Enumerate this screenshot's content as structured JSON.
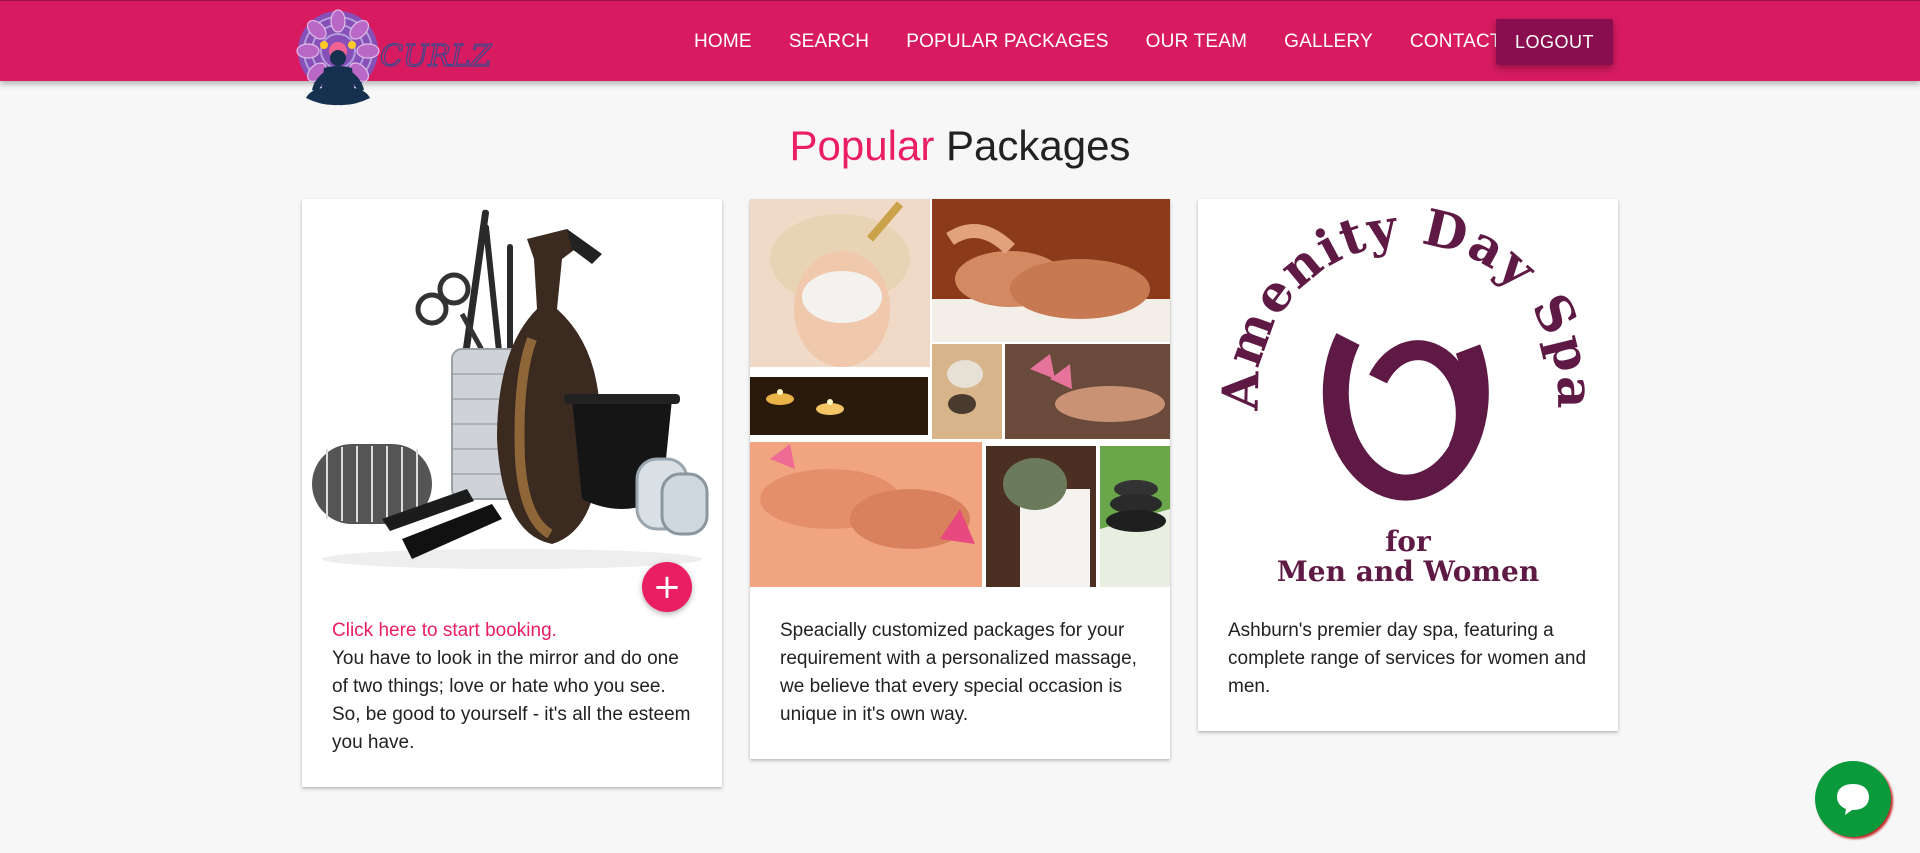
{
  "brand": {
    "logo_text": "CURLZ"
  },
  "nav": {
    "items": [
      {
        "label": "HOME"
      },
      {
        "label": "SEARCH"
      },
      {
        "label": "POPULAR PACKAGES"
      },
      {
        "label": "OUR TEAM"
      },
      {
        "label": "GALLERY"
      },
      {
        "label": "CONTACT"
      }
    ],
    "logout_label": "LOGOUT"
  },
  "section": {
    "title_accent": "Popular",
    "title_rest": " Packages"
  },
  "cards": [
    {
      "image": "hair-tools-image",
      "link_text": "Click here to start booking.",
      "add_icon": "+",
      "text": "You have to look in the mirror and do one of two things; love or hate who you see. So, be good to yourself - it's all the esteem you have."
    },
    {
      "image": "spa-collage-image",
      "text": "Speacially customized packages for your requirement with a personalized massage, we believe that every special occasion is unique in it's own way."
    },
    {
      "image": "amenity-day-spa-logo",
      "logo_arc": "Amenity Day Spa",
      "logo_for": "for",
      "logo_sub": "Men and Women",
      "text": "Ashburn's premier day spa, featuring a complete range of services for women and men."
    }
  ],
  "colors": {
    "primary": "#d81b60",
    "accent": "#e91e63",
    "logout": "#880e4f",
    "chat": "#0a9a3c",
    "spa_logo": "#5e1a44"
  },
  "chat": {
    "icon": "chat-bubble-icon"
  }
}
